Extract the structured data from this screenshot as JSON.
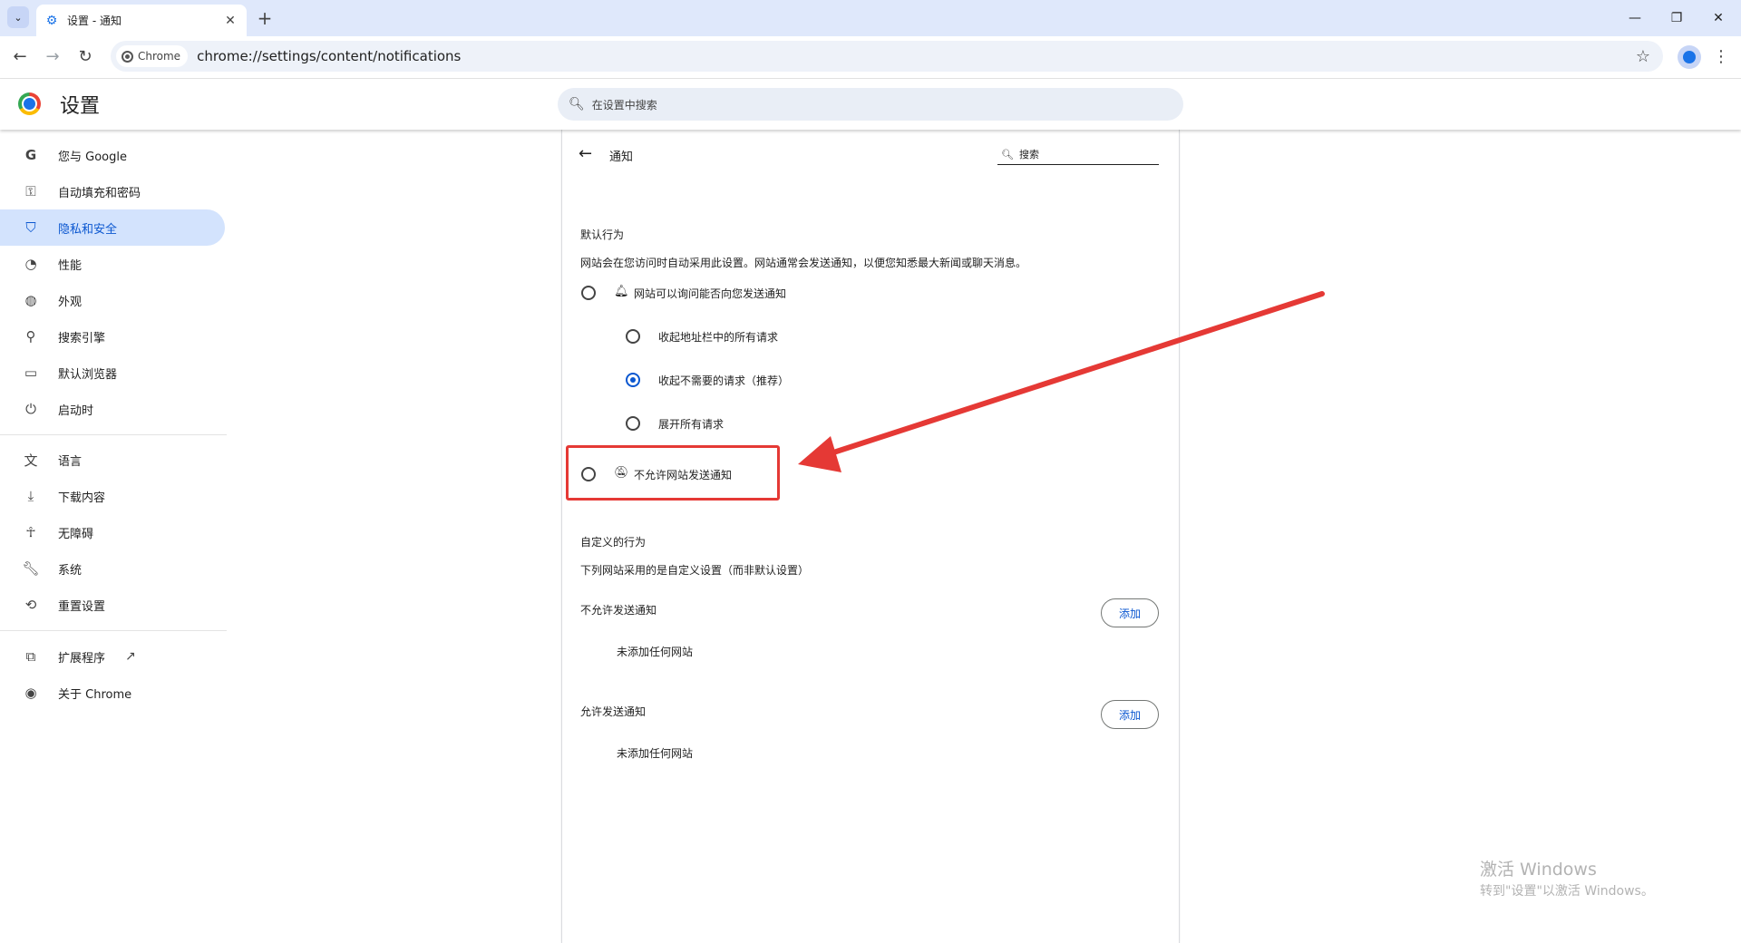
{
  "browser": {
    "tab_title": "设置 - 通知",
    "chip_label": "Chrome",
    "url": "chrome://settings/content/notifications"
  },
  "header": {
    "title": "设置",
    "search_placeholder": "在设置中搜索"
  },
  "sidebar": {
    "items": [
      {
        "label": "您与 Google",
        "icon": "google-g-icon"
      },
      {
        "label": "自动填充和密码",
        "icon": "key-icon"
      },
      {
        "label": "隐私和安全",
        "icon": "shield-icon",
        "active": true
      },
      {
        "label": "性能",
        "icon": "speedometer-icon"
      },
      {
        "label": "外观",
        "icon": "palette-icon"
      },
      {
        "label": "搜索引擎",
        "icon": "search-icon"
      },
      {
        "label": "默认浏览器",
        "icon": "browser-window-icon"
      },
      {
        "label": "启动时",
        "icon": "power-icon"
      },
      {
        "label": "语言",
        "icon": "translate-icon"
      },
      {
        "label": "下载内容",
        "icon": "download-icon"
      },
      {
        "label": "无障碍",
        "icon": "accessibility-icon"
      },
      {
        "label": "系统",
        "icon": "wrench-icon"
      },
      {
        "label": "重置设置",
        "icon": "reset-icon"
      },
      {
        "label": "扩展程序",
        "icon": "puzzle-icon"
      },
      {
        "label": "关于 Chrome",
        "icon": "chrome-icon"
      }
    ]
  },
  "main": {
    "title": "通知",
    "search_label": "搜索",
    "default_behavior": {
      "title": "默认行为",
      "description": "网站会在您访问时自动采用此设置。网站通常会发送通知，以便您知悉最大新闻或聊天消息。",
      "options": {
        "ask": "网站可以询问能否向您发送通知",
        "collapse_all": "收起地址栏中的所有请求",
        "collapse_unwanted": "收起不需要的请求（推荐）",
        "expand_all": "展开所有请求",
        "block": "不允许网站发送通知"
      }
    },
    "custom_behavior": {
      "title": "自定义的行为",
      "description": "下列网站采用的是自定义设置（而非默认设置）",
      "blocked": {
        "title": "不允许发送通知",
        "add_label": "添加",
        "empty": "未添加任何网站"
      },
      "allowed": {
        "title": "允许发送通知",
        "add_label": "添加",
        "empty": "未添加任何网站"
      }
    }
  },
  "watermark": {
    "line1": "激活 Windows",
    "line2": "转到\"设置\"以激活 Windows。"
  },
  "colors": {
    "accent": "#0b57d0",
    "active_bg": "#d3e3fd",
    "annotation_red": "#e53935",
    "tabstrip_bg": "#dfe8fb"
  }
}
